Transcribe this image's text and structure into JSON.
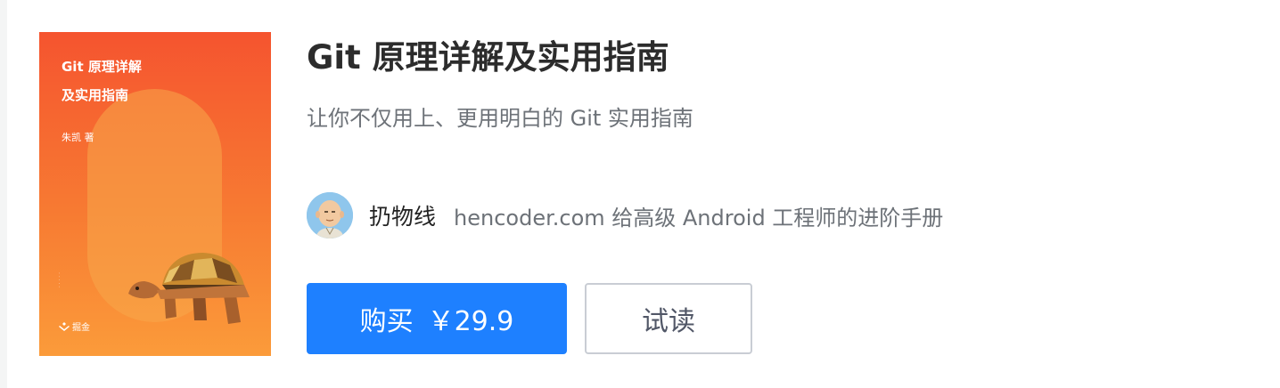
{
  "book": {
    "title": "Git 原理详解及实用指南",
    "description": "让你不仅用上、更用明白的 Git 实用指南",
    "cover": {
      "title_line1": "Git 原理详解",
      "title_line2": "及实用指南",
      "author": "朱凯 著",
      "publisher": "掘金",
      "gradient_top": "#f5542f",
      "gradient_bottom": "#fb9b3a",
      "illustration": "turtle"
    }
  },
  "author": {
    "name": "扔物线",
    "bio": "hencoder.com 给高级 Android 工程师的进阶手册",
    "avatar_icon": "monk-avatar-icon"
  },
  "actions": {
    "buy_label": "购买",
    "price": "￥29.9",
    "trial_label": "试读",
    "accent_color": "#1e80ff"
  }
}
